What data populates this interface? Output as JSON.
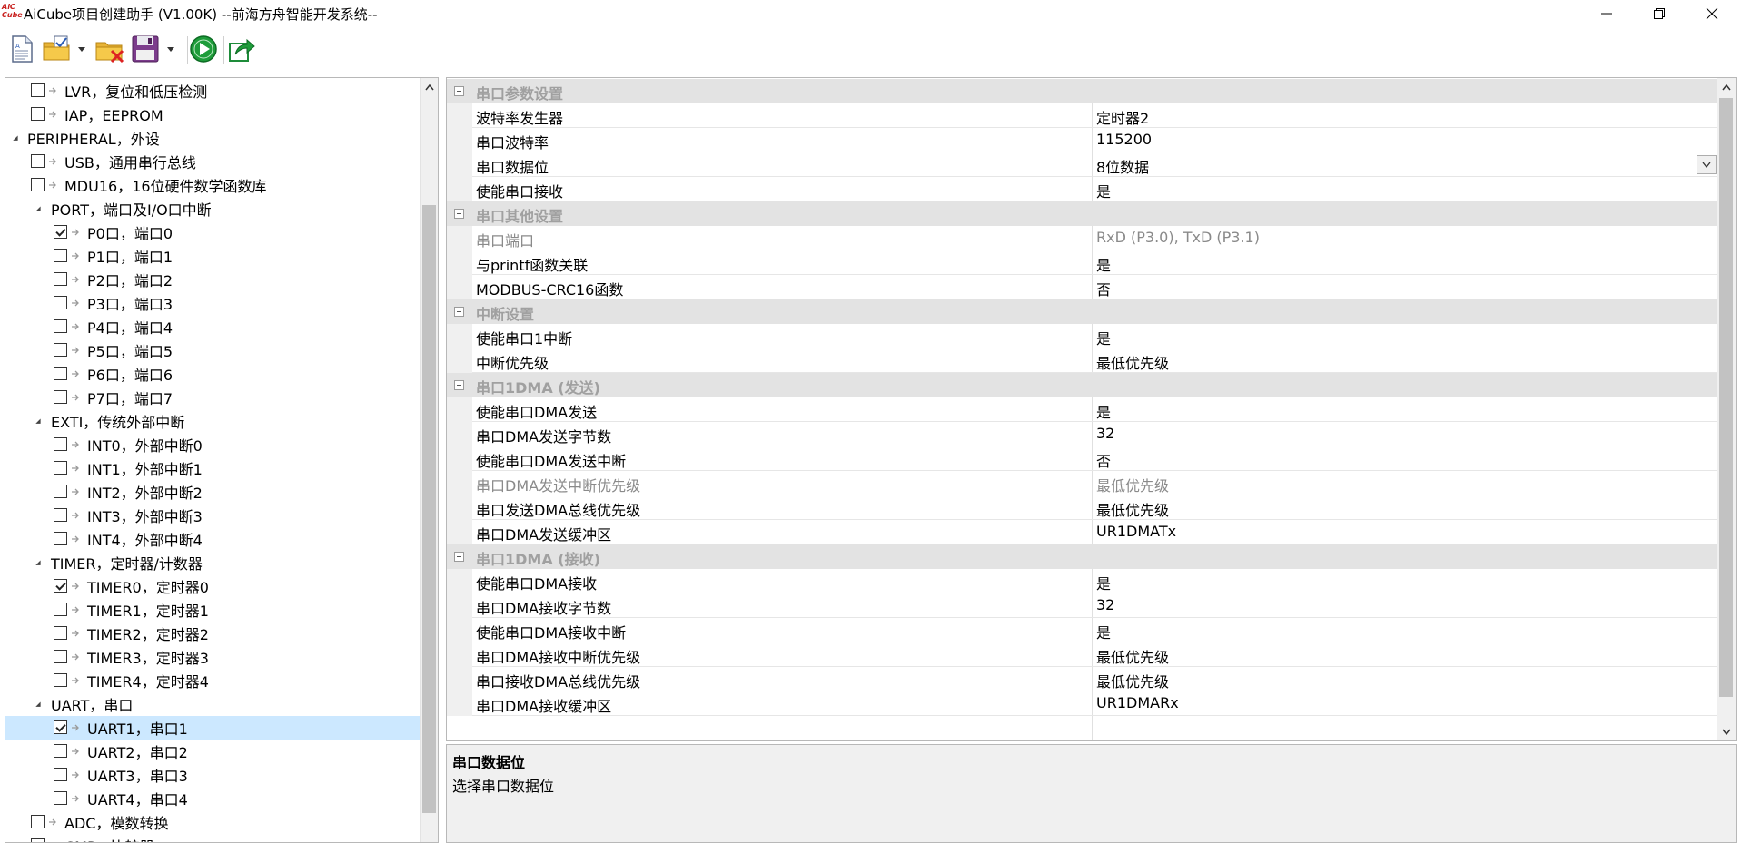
{
  "window": {
    "title": "AiCube项目创建助手 (V1.00K) --前海方舟智能开发系统--",
    "logo_top": "AiC",
    "logo_bottom": "Cube"
  },
  "toolbar": {
    "buttons": [
      "new-project-icon",
      "open-project-icon",
      "close-project-icon",
      "save-project-icon",
      "run-generate-icon",
      "export-icon"
    ]
  },
  "tree": {
    "items": [
      {
        "label": "LVR，复位和低压检测",
        "checked": false,
        "level": 1,
        "expander": false
      },
      {
        "label": "IAP，EEPROM",
        "checked": false,
        "level": 1,
        "expander": false
      },
      {
        "label": "PERIPHERAL，外设",
        "checked": null,
        "level": 0,
        "expander": true
      },
      {
        "label": "USB，通用串行总线",
        "checked": false,
        "level": 1,
        "expander": false
      },
      {
        "label": "MDU16，16位硬件数学函数库",
        "checked": false,
        "level": 1,
        "expander": false
      },
      {
        "label": "PORT，端口及I/O口中断",
        "checked": null,
        "level": 1,
        "expander": true
      },
      {
        "label": "P0口，端口0",
        "checked": true,
        "level": 2,
        "expander": false
      },
      {
        "label": "P1口，端口1",
        "checked": false,
        "level": 2,
        "expander": false
      },
      {
        "label": "P2口，端口2",
        "checked": false,
        "level": 2,
        "expander": false
      },
      {
        "label": "P3口，端口3",
        "checked": false,
        "level": 2,
        "expander": false
      },
      {
        "label": "P4口，端口4",
        "checked": false,
        "level": 2,
        "expander": false
      },
      {
        "label": "P5口，端口5",
        "checked": false,
        "level": 2,
        "expander": false
      },
      {
        "label": "P6口，端口6",
        "checked": false,
        "level": 2,
        "expander": false
      },
      {
        "label": "P7口，端口7",
        "checked": false,
        "level": 2,
        "expander": false
      },
      {
        "label": "EXTI，传统外部中断",
        "checked": null,
        "level": 1,
        "expander": true
      },
      {
        "label": "INT0，外部中断0",
        "checked": false,
        "level": 2,
        "expander": false
      },
      {
        "label": "INT1，外部中断1",
        "checked": false,
        "level": 2,
        "expander": false
      },
      {
        "label": "INT2，外部中断2",
        "checked": false,
        "level": 2,
        "expander": false
      },
      {
        "label": "INT3，外部中断3",
        "checked": false,
        "level": 2,
        "expander": false
      },
      {
        "label": "INT4，外部中断4",
        "checked": false,
        "level": 2,
        "expander": false
      },
      {
        "label": "TIMER，定时器/计数器",
        "checked": null,
        "level": 1,
        "expander": true
      },
      {
        "label": "TIMER0，定时器0",
        "checked": true,
        "level": 2,
        "expander": false
      },
      {
        "label": "TIMER1，定时器1",
        "checked": false,
        "level": 2,
        "expander": false
      },
      {
        "label": "TIMER2，定时器2",
        "checked": false,
        "level": 2,
        "expander": false
      },
      {
        "label": "TIMER3，定时器3",
        "checked": false,
        "level": 2,
        "expander": false
      },
      {
        "label": "TIMER4，定时器4",
        "checked": false,
        "level": 2,
        "expander": false
      },
      {
        "label": "UART，串口",
        "checked": null,
        "level": 1,
        "expander": true
      },
      {
        "label": "UART1，串口1",
        "checked": true,
        "level": 2,
        "expander": false,
        "selected": true
      },
      {
        "label": "UART2，串口2",
        "checked": false,
        "level": 2,
        "expander": false
      },
      {
        "label": "UART3，串口3",
        "checked": false,
        "level": 2,
        "expander": false
      },
      {
        "label": "UART4，串口4",
        "checked": false,
        "level": 2,
        "expander": false
      },
      {
        "label": "ADC，模数转换",
        "checked": false,
        "level": 1,
        "expander": false
      },
      {
        "label": "CMP，比较器",
        "checked": false,
        "level": 1,
        "expander": false
      }
    ]
  },
  "grid": {
    "rows": [
      {
        "type": "category",
        "label": "串口参数设置"
      },
      {
        "type": "prop",
        "name": "波特率发生器",
        "value": "定时器2"
      },
      {
        "type": "prop",
        "name": "串口波特率",
        "value": "115200"
      },
      {
        "type": "prop",
        "name": "串口数据位",
        "value": "8位数据",
        "dropdown": true
      },
      {
        "type": "prop",
        "name": "使能串口接收",
        "value": "是"
      },
      {
        "type": "category",
        "label": "串口其他设置"
      },
      {
        "type": "prop",
        "name": "串口端口",
        "value": "RxD (P3.0), TxD (P3.1)",
        "disabled": true
      },
      {
        "type": "prop",
        "name": "与printf函数关联",
        "value": "是"
      },
      {
        "type": "prop",
        "name": "MODBUS-CRC16函数",
        "value": "否"
      },
      {
        "type": "category",
        "label": "中断设置"
      },
      {
        "type": "prop",
        "name": "使能串口1中断",
        "value": "是"
      },
      {
        "type": "prop",
        "name": "中断优先级",
        "value": "最低优先级"
      },
      {
        "type": "category",
        "label": "串口1DMA (发送)"
      },
      {
        "type": "prop",
        "name": "使能串口DMA发送",
        "value": "是"
      },
      {
        "type": "prop",
        "name": "串口DMA发送字节数",
        "value": "32"
      },
      {
        "type": "prop",
        "name": "使能串口DMA发送中断",
        "value": "否"
      },
      {
        "type": "prop",
        "name": "串口DMA发送中断优先级",
        "value": "最低优先级",
        "disabled": true
      },
      {
        "type": "prop",
        "name": "串口发送DMA总线优先级",
        "value": "最低优先级"
      },
      {
        "type": "prop",
        "name": "串口DMA发送缓冲区",
        "value": "UR1DMATx"
      },
      {
        "type": "category",
        "label": "串口1DMA (接收)"
      },
      {
        "type": "prop",
        "name": "使能串口DMA接收",
        "value": "是"
      },
      {
        "type": "prop",
        "name": "串口DMA接收字节数",
        "value": "32"
      },
      {
        "type": "prop",
        "name": "使能串口DMA接收中断",
        "value": "是"
      },
      {
        "type": "prop",
        "name": "串口DMA接收中断优先级",
        "value": "最低优先级"
      },
      {
        "type": "prop",
        "name": "串口接收DMA总线优先级",
        "value": "最低优先级"
      },
      {
        "type": "prop",
        "name": "串口DMA接收缓冲区",
        "value": "UR1DMARx"
      }
    ]
  },
  "description": {
    "title": "串口数据位",
    "text": "选择串口数据位"
  },
  "colors": {
    "selection": "#cce8ff",
    "category_bg": "#e3e3e3",
    "run_green": "#1e9c3a",
    "logo_red": "#c8201e"
  }
}
